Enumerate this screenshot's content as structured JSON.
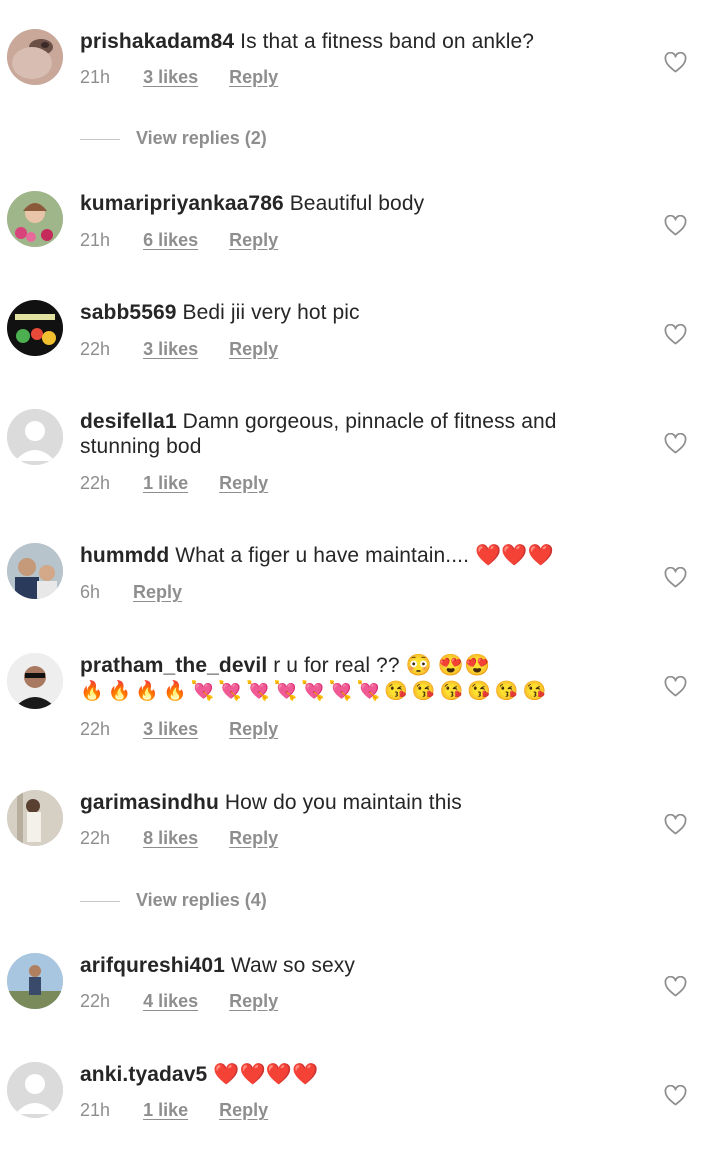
{
  "comments": [
    {
      "username": "prishakadam84",
      "text": "Is that a fitness band on ankle?",
      "time": "21h",
      "likes": "3 likes",
      "reply": "Reply",
      "avatar": "avatar-woman-closeup"
    },
    {
      "username": "kumaripriyankaa786",
      "text": "Beautiful body",
      "time": "21h",
      "likes": "6 likes",
      "reply": "Reply",
      "avatar": "avatar-child-flowers"
    },
    {
      "username": "sabb5569",
      "text": "Bedi jii very hot pic",
      "time": "22h",
      "likes": "3 likes",
      "reply": "Reply",
      "avatar": "avatar-dark-graphic"
    },
    {
      "username": "desifella1",
      "text": "Damn gorgeous, pinnacle of fitness and stunning bod",
      "time": "22h",
      "likes": "1 like",
      "reply": "Reply",
      "avatar": "avatar-default"
    },
    {
      "username": "hummdd",
      "text": "What a figer u have maintain.... ❤️❤️❤️",
      "time": "6h",
      "likes": "",
      "reply": "Reply",
      "avatar": "avatar-two-men"
    },
    {
      "username": "pratham_the_devil",
      "text": "r u for real ?? 😳 😍😍",
      "text2": "🔥🔥🔥🔥💘💘💘💘💘💘💘😘😘😘😘😘😘",
      "time": "22h",
      "likes": "3 likes",
      "reply": "Reply",
      "avatar": "avatar-man-sunglasses"
    },
    {
      "username": "garimasindhu",
      "text": "How do you maintain this",
      "time": "22h",
      "likes": "8 likes",
      "reply": "Reply",
      "avatar": "avatar-woman-standing"
    },
    {
      "username": "arifqureshi401",
      "text": "Waw so sexy",
      "time": "22h",
      "likes": "4 likes",
      "reply": "Reply",
      "avatar": "avatar-man-outdoor"
    },
    {
      "username": "anki.tyadav5",
      "text": "❤️❤️❤️❤️",
      "time": "21h",
      "likes": "1 like",
      "reply": "Reply",
      "avatar": "avatar-default"
    }
  ],
  "view_replies": [
    {
      "label": "View replies (2)"
    },
    {
      "label": "View replies (4)"
    }
  ],
  "icons": {
    "like": "heart-outline-icon"
  },
  "colors": {
    "text": "#262626",
    "meta": "#8e8e8e",
    "divider": "#c7c7c7"
  }
}
